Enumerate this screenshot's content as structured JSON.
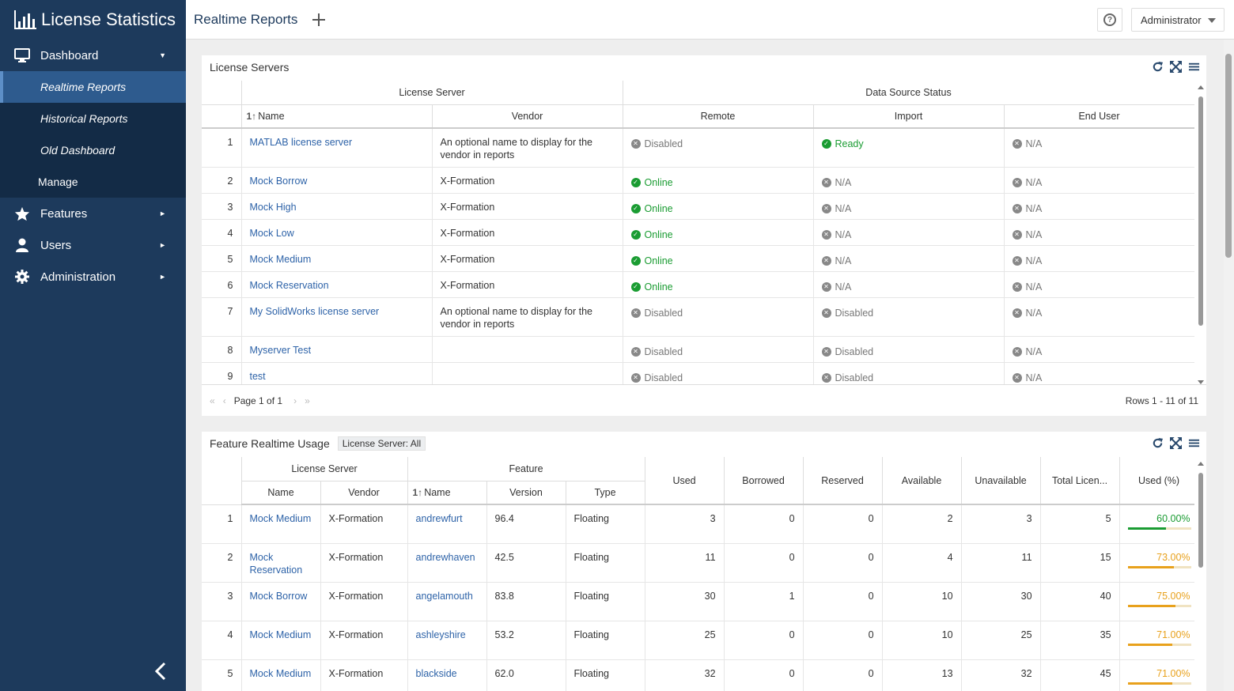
{
  "app": {
    "title": "License Statistics"
  },
  "sidebar": {
    "items": [
      {
        "label": "Dashboard",
        "icon": "monitor-icon",
        "caret": "▼"
      },
      {
        "label": "Features",
        "icon": "star-icon",
        "caret": "►"
      },
      {
        "label": "Users",
        "icon": "user-icon",
        "caret": "►"
      },
      {
        "label": "Administration",
        "icon": "gear-icon",
        "caret": "►"
      }
    ],
    "dashboard_sub": [
      "Realtime Reports",
      "Historical Reports",
      "Old Dashboard"
    ],
    "manage": "Manage"
  },
  "header": {
    "title": "Realtime Reports",
    "user": "Administrator"
  },
  "license_servers": {
    "title": "License Servers",
    "group_headers": {
      "server": "License Server",
      "status": "Data Source Status"
    },
    "columns": {
      "name": "Name",
      "vendor": "Vendor",
      "remote": "Remote",
      "import": "Import",
      "end_user": "End User"
    },
    "rows": [
      {
        "idx": "1",
        "name": "MATLAB license server",
        "vendor": "An optional name to display for the vendor in reports",
        "remote": "Disabled",
        "import": "Ready",
        "end_user": "N/A",
        "remote_ok": false,
        "import_ok": true
      },
      {
        "idx": "2",
        "name": "Mock Borrow",
        "vendor": "X-Formation",
        "remote": "Online",
        "import": "N/A",
        "end_user": "N/A",
        "remote_ok": true,
        "import_ok": false
      },
      {
        "idx": "3",
        "name": "Mock High",
        "vendor": "X-Formation",
        "remote": "Online",
        "import": "N/A",
        "end_user": "N/A",
        "remote_ok": true,
        "import_ok": false
      },
      {
        "idx": "4",
        "name": "Mock Low",
        "vendor": "X-Formation",
        "remote": "Online",
        "import": "N/A",
        "end_user": "N/A",
        "remote_ok": true,
        "import_ok": false
      },
      {
        "idx": "5",
        "name": "Mock Medium",
        "vendor": "X-Formation",
        "remote": "Online",
        "import": "N/A",
        "end_user": "N/A",
        "remote_ok": true,
        "import_ok": false
      },
      {
        "idx": "6",
        "name": "Mock Reservation",
        "vendor": "X-Formation",
        "remote": "Online",
        "import": "N/A",
        "end_user": "N/A",
        "remote_ok": true,
        "import_ok": false
      },
      {
        "idx": "7",
        "name": "My SolidWorks license server",
        "vendor": "An optional name to display for the vendor in reports",
        "remote": "Disabled",
        "import": "Disabled",
        "end_user": "N/A",
        "remote_ok": false,
        "import_ok": false
      },
      {
        "idx": "8",
        "name": "Myserver Test",
        "vendor": "",
        "remote": "Disabled",
        "import": "Disabled",
        "end_user": "N/A",
        "remote_ok": false,
        "import_ok": false
      },
      {
        "idx": "9",
        "name": "test",
        "vendor": "",
        "remote": "Disabled",
        "import": "Disabled",
        "end_user": "N/A",
        "remote_ok": false,
        "import_ok": false
      }
    ],
    "pager": {
      "page": "Page 1 of 1",
      "rows": "Rows 1 - 11 of 11"
    }
  },
  "feature_usage": {
    "title": "Feature Realtime Usage",
    "filter": "License Server: All",
    "group_headers": {
      "server": "License Server",
      "feature": "Feature"
    },
    "columns": {
      "name": "Name",
      "vendor": "Vendor",
      "fname": "Name",
      "version": "Version",
      "type": "Type",
      "used": "Used",
      "borrowed": "Borrowed",
      "reserved": "Reserved",
      "available": "Available",
      "unavailable": "Unavailable",
      "total": "Total Licen...",
      "used_pct": "Used (%)"
    },
    "rows": [
      {
        "idx": "1",
        "server": "Mock Medium",
        "vendor": "X-Formation",
        "feature": "andrewfurt",
        "version": "96.4",
        "type": "Floating",
        "used": "3",
        "borrowed": "0",
        "reserved": "0",
        "available": "2",
        "unavailable": "3",
        "total": "5",
        "pct": "60.00%",
        "pct_value": 60,
        "color": "#1a9c32"
      },
      {
        "idx": "2",
        "server": "Mock Reservation",
        "vendor": "X-Formation",
        "feature": "andrewhaven",
        "version": "42.5",
        "type": "Floating",
        "used": "11",
        "borrowed": "0",
        "reserved": "0",
        "available": "4",
        "unavailable": "11",
        "total": "15",
        "pct": "73.00%",
        "pct_value": 73,
        "color": "#e8a11c"
      },
      {
        "idx": "3",
        "server": "Mock Borrow",
        "vendor": "X-Formation",
        "feature": "angelamouth",
        "version": "83.8",
        "type": "Floating",
        "used": "30",
        "borrowed": "1",
        "reserved": "0",
        "available": "10",
        "unavailable": "30",
        "total": "40",
        "pct": "75.00%",
        "pct_value": 75,
        "color": "#e8a11c"
      },
      {
        "idx": "4",
        "server": "Mock Medium",
        "vendor": "X-Formation",
        "feature": "ashleyshire",
        "version": "53.2",
        "type": "Floating",
        "used": "25",
        "borrowed": "0",
        "reserved": "0",
        "available": "10",
        "unavailable": "25",
        "total": "35",
        "pct": "71.00%",
        "pct_value": 71,
        "color": "#e8a11c"
      },
      {
        "idx": "5",
        "server": "Mock Medium",
        "vendor": "X-Formation",
        "feature": "blackside",
        "version": "62.0",
        "type": "Floating",
        "used": "32",
        "borrowed": "0",
        "reserved": "0",
        "available": "13",
        "unavailable": "32",
        "total": "45",
        "pct": "71.00%",
        "pct_value": 71,
        "color": "#e8a11c"
      }
    ]
  }
}
